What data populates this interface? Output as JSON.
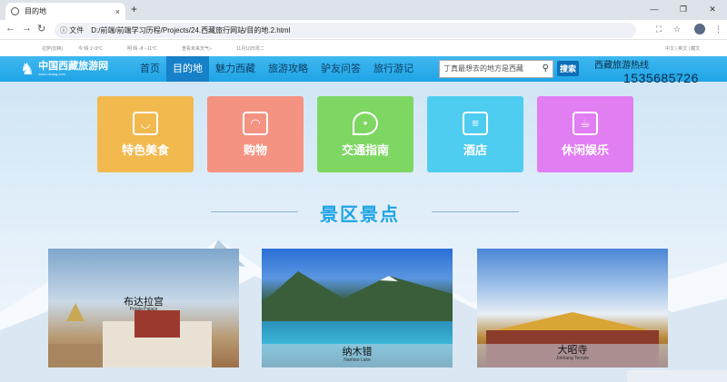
{
  "browser": {
    "tab_title": "目的地",
    "tab_close": "×",
    "new_tab": "+",
    "win_min": "—",
    "win_max": "❐",
    "win_close": "✕",
    "back": "←",
    "forward": "→",
    "reload": "↻",
    "info_label": "ⓘ 文件",
    "url": "D:/前端/前端学习历程/Projects/24.西藏旅行网站/目的地.2.html"
  },
  "site": {
    "strip": {
      "left": "拉萨(切换)",
      "weather1": "今 晴 1~9℃",
      "weather2": "明 晴 -8~-11℃",
      "weather3": "查看未来天气»",
      "date": "11月10日周二",
      "langs": "中文 | 英文 | 藏文"
    },
    "logo": {
      "title": "中国西藏旅游网",
      "sub": "www.xizang.com"
    },
    "nav": [
      "首页",
      "目的地",
      "魅力西藏",
      "旅游攻略",
      "驴友问答",
      "旅行游记"
    ],
    "search": {
      "placeholder": "丁真最想去的地方是西藏",
      "button": "搜索"
    },
    "hotline": {
      "label": "西藏旅游热线",
      "number": "1535685726"
    },
    "cards": [
      {
        "label": "特色美食",
        "icon": "bowl-icon",
        "color": "#f2b94f"
      },
      {
        "label": "购物",
        "icon": "bag-icon",
        "color": "#f59382"
      },
      {
        "label": "交通指南",
        "icon": "location-icon",
        "color": "#7ed763"
      },
      {
        "label": "酒店",
        "icon": "building-icon",
        "color": "#4fcdf0"
      },
      {
        "label": "休闲娱乐",
        "icon": "cup-icon",
        "color": "#e17ef2"
      }
    ],
    "section_title": "景区景点",
    "scenics": [
      {
        "name": "布达拉宫",
        "sub": "Potala Palace"
      },
      {
        "name": "纳木错",
        "sub": "Namtso Lake"
      },
      {
        "name": "大昭寺",
        "sub": "Jokhang Temple"
      }
    ]
  }
}
